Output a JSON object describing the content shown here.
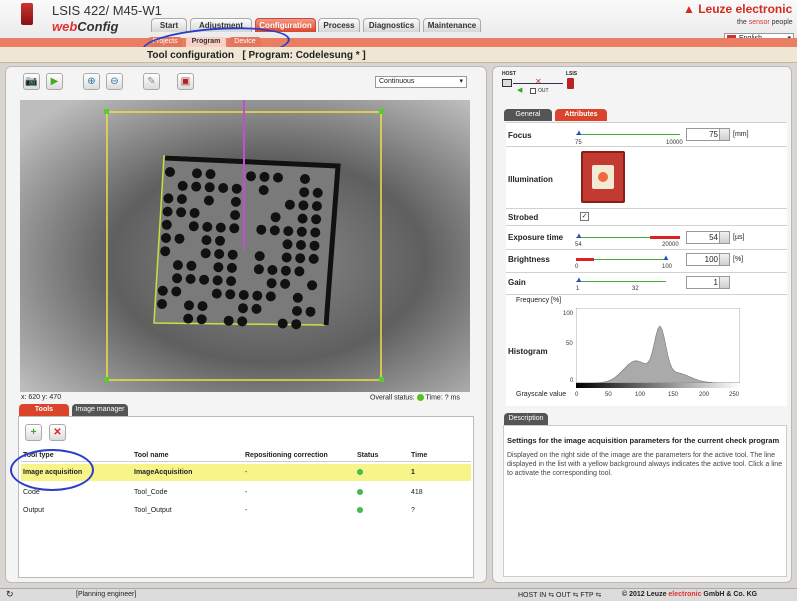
{
  "header": {
    "product": "LSIS 422/ M45-W1",
    "app_web": "web",
    "app_config": "Config",
    "brand": "Leuze electronic",
    "tagline_pre": "the ",
    "tagline_sensor": "sensor",
    "tagline_post": " people",
    "language": "English"
  },
  "main_tabs": [
    "Start",
    "Adjustment",
    "Configuration",
    "Process",
    "Diagnostics",
    "Maintenance"
  ],
  "sub_tabs": [
    "Projects",
    "Program",
    "Device"
  ],
  "page_title": "Tool configuration   [ Program: Codelesung * ]",
  "toolbar": {
    "mode": "Continuous"
  },
  "image_status": {
    "coords": "x: 620 y: 470",
    "overall": "Overall status:",
    "time": "Time: ? ms"
  },
  "bottom_tabs": [
    "Tools",
    "Image manager"
  ],
  "tools_table": {
    "headers": [
      "Tool type",
      "Tool name",
      "Repositioning correction",
      "Status",
      "Time"
    ],
    "rows": [
      [
        "Image acquisition",
        "ImageAcquisition",
        "-",
        "",
        "1"
      ],
      [
        "Code",
        "Tool_Code",
        "-",
        "",
        "418"
      ],
      [
        "Output",
        "Tool_Output",
        "-",
        "",
        "?"
      ]
    ]
  },
  "host": {
    "host": "HOST",
    "lsis": "LSIS",
    "out": "OUT"
  },
  "right_tabs": [
    "General",
    "Attributes"
  ],
  "params": {
    "focus": {
      "label": "Focus",
      "value": "75",
      "unit": "[mm]",
      "min": "75",
      "max": "10000"
    },
    "illumination": {
      "label": "Illumination"
    },
    "strobed": {
      "label": "Strobed",
      "checked": "✓"
    },
    "exposure": {
      "label": "Exposure time",
      "value": "54",
      "unit": "[µs]",
      "min": "54",
      "max": "20000"
    },
    "brightness": {
      "label": "Brightness",
      "value": "100",
      "unit": "[%]",
      "min": "0",
      "max": "100"
    },
    "gain": {
      "label": "Gain",
      "value": "1",
      "unit": "",
      "min": "1",
      "max": "32"
    }
  },
  "histogram": {
    "label": "Histogram",
    "ylabel": "Frequency [%]",
    "xlabel": "Grayscale value",
    "yticks": [
      "100",
      "50",
      "0"
    ],
    "xticks": [
      "0",
      "50",
      "100",
      "150",
      "200",
      "250"
    ]
  },
  "description": {
    "tab": "Description",
    "title": "Settings for the image acquisition parameters for the current check program",
    "text": "Displayed on the right side of the image are the parameters for the active tool. The line displayed in the list with a yellow background always indicates the active tool. Click a line to activate the corresponding tool."
  },
  "footer": {
    "role": "[Planning engineer]",
    "status": "HOST IN ⇆ OUT ⇆ FTP ⇆",
    "copyright_pre": "© 2012 Leuze ",
    "copyright_el": "electronic",
    "copyright_post": " GmbH & Co. KG"
  },
  "colors": {
    "accent": "#e0442c",
    "active_row": "#f7f48a",
    "status_green": "#54c020"
  }
}
